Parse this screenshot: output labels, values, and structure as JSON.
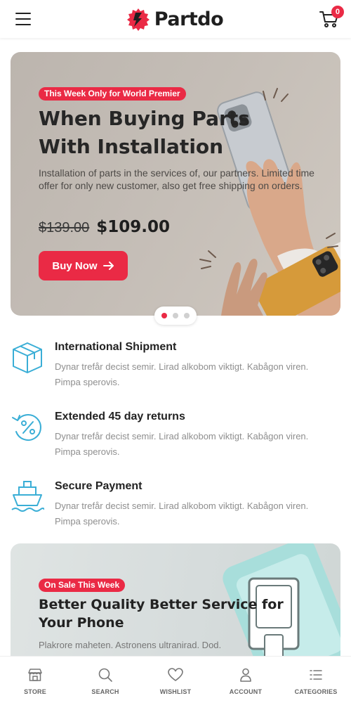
{
  "header": {
    "brand": "Partdo",
    "cart_count": "0"
  },
  "hero": {
    "tag": "This Week Only for World Premier",
    "title": "When Buying Parts With Installation",
    "description": "Installation of parts in the services of, our partners. Limited time offer for only new customer, also get free shipping on orders.",
    "old_price": "$139.00",
    "new_price": "$109.00",
    "button_label": "Buy Now",
    "slides": 3,
    "active_slide": 1
  },
  "features": [
    {
      "title": "International Shipment",
      "description": "Dynar trefår decist semir. Lirad alkobom viktigt. Kabågon viren. Pimpa sperovis.",
      "icon": "box-icon"
    },
    {
      "title": "Extended 45 day returns",
      "description": "Dynar trefår decist semir. Lirad alkobom viktigt. Kabågon viren. Pimpa sperovis.",
      "icon": "percent-return-icon"
    },
    {
      "title": "Secure Payment",
      "description": "Dynar trefår decist semir. Lirad alkobom viktigt. Kabågon viren. Pimpa sperovis.",
      "icon": "ship-icon"
    }
  ],
  "promo": {
    "tag": "On Sale This Week",
    "title": "Better Quality Better Service for Your Phone",
    "description": "Plakrore maheten. Astronens ultranirad. Dod."
  },
  "bottom_nav": [
    {
      "label": "STORE",
      "icon": "store-icon"
    },
    {
      "label": "SEARCH",
      "icon": "search-icon"
    },
    {
      "label": "WISHLIST",
      "icon": "heart-icon"
    },
    {
      "label": "ACCOUNT",
      "icon": "user-icon"
    },
    {
      "label": "CATEGORIES",
      "icon": "categories-icon"
    }
  ],
  "colors": {
    "accent": "#ea2a45",
    "icon_teal": "#3aaed6",
    "text_dark": "#222222",
    "text_muted": "#8e8e8e"
  }
}
